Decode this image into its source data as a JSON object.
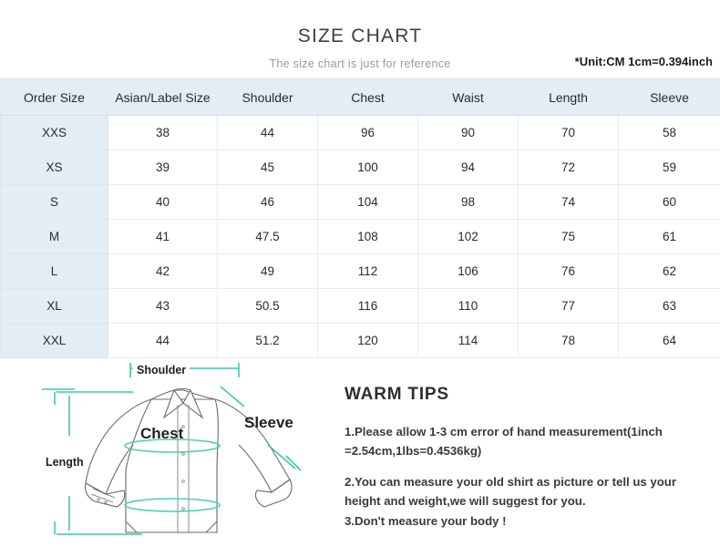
{
  "header": {
    "title": "SIZE CHART",
    "subtitle": "The size chart is just for reference",
    "unit_note": "*Unit:CM 1cm=0.394inch"
  },
  "table": {
    "columns": [
      "Order Size",
      "Asian/Label Size",
      "Shoulder",
      "Chest",
      "Waist",
      "Length",
      "Sleeve"
    ],
    "rows": [
      [
        "XXS",
        "38",
        "44",
        "96",
        "90",
        "70",
        "58"
      ],
      [
        "XS",
        "39",
        "45",
        "100",
        "94",
        "72",
        "59"
      ],
      [
        "S",
        "40",
        "46",
        "104",
        "98",
        "74",
        "60"
      ],
      [
        "M",
        "41",
        "47.5",
        "108",
        "102",
        "75",
        "61"
      ],
      [
        "L",
        "42",
        "49",
        "112",
        "106",
        "76",
        "62"
      ],
      [
        "XL",
        "43",
        "50.5",
        "116",
        "110",
        "77",
        "63"
      ],
      [
        "XXL",
        "44",
        "51.2",
        "120",
        "114",
        "78",
        "64"
      ]
    ]
  },
  "diagram": {
    "labels": {
      "shoulder": "Shoulder",
      "chest": "Chest",
      "sleeve": "Sleeve",
      "length": "Length"
    },
    "measure_color": "#3ec6ad",
    "outline_color": "#6b6b6b"
  },
  "tips": {
    "title": "WARM TIPS",
    "lines": [
      "1.Please allow 1-3 cm error of hand measurement(1inch",
      "=2.54cm,1lbs=0.4536kg)",
      "2.You can measure your old shirt as picture or tell us your",
      "height and weight,we will suggest for you.",
      "3.Don't measure your body !"
    ]
  },
  "colors": {
    "header_bg": "#e2edf6",
    "accent_teal": "#3ec6ad",
    "text": "#2b2b2b"
  }
}
